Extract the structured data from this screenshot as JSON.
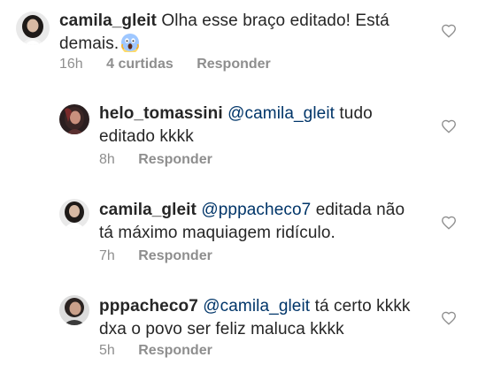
{
  "comments": [
    {
      "username": "camila_gleit",
      "mention": "",
      "text_line1": "Olha esse braço editado! Está",
      "text_line2": "demais.",
      "emoji": "scream-emoji",
      "time": "16h",
      "likes": "4 curtidas",
      "reply": "Responder"
    },
    {
      "username": "helo_tomassini",
      "mention": "@camila_gleit",
      "text_line1": "tudo",
      "text_line2": "editado kkkk",
      "time": "8h",
      "reply": "Responder"
    },
    {
      "username": "camila_gleit",
      "mention": "@pppacheco7",
      "text_line1": "editada não",
      "text_line2": "tá máximo maquiagem ridículo.",
      "time": "7h",
      "reply": "Responder"
    },
    {
      "username": "pppacheco7",
      "mention": "@camila_gleit",
      "text_line1": "tá certo kkkk",
      "text_line2": "dxa o povo ser feliz maluca kkkk",
      "time": "5h",
      "reply": "Responder"
    }
  ],
  "icons": {
    "like": "heart-outline-icon",
    "scream": "face-screaming-emoji"
  },
  "colors": {
    "text": "#262626",
    "meta": "#8e8e8e",
    "mention": "#003569",
    "heart": "#8e8e8e"
  }
}
